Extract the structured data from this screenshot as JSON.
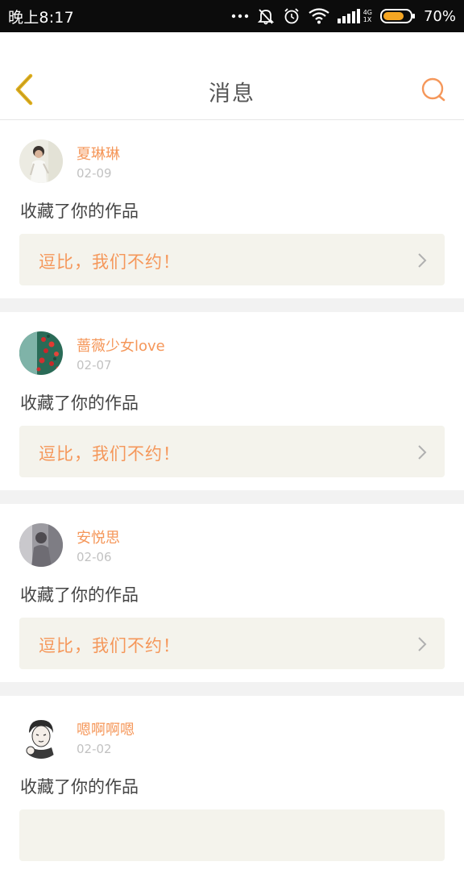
{
  "status_bar": {
    "time": "晚上8:17",
    "network": "4G",
    "network_secondary": "1X",
    "battery_percent": "70%",
    "battery_level": 0.7,
    "icons": [
      "more-icon",
      "notification-off-icon",
      "alarm-icon",
      "wifi-icon",
      "signal-icon",
      "battery-icon"
    ]
  },
  "header": {
    "title": "消息",
    "back_icon": "chevron-left-icon",
    "search_icon": "search-icon"
  },
  "colors": {
    "accent": "#f5975a",
    "back_icon": "#e0b020",
    "quote_bg": "#f4f3ec",
    "date": "#c2c2c2",
    "text": "#444444"
  },
  "messages": [
    {
      "username": "夏琳琳",
      "date": "02-09",
      "action": "收藏了你的作品",
      "quote": "逗比，我们不约！"
    },
    {
      "username": "蔷薇少女love",
      "date": "02-07",
      "action": "收藏了你的作品",
      "quote": "逗比，我们不约！"
    },
    {
      "username": "安悦思",
      "date": "02-06",
      "action": "收藏了你的作品",
      "quote": "逗比，我们不约！"
    },
    {
      "username": "嗯啊啊嗯",
      "date": "02-02",
      "action": "收藏了你的作品",
      "quote": ""
    }
  ]
}
